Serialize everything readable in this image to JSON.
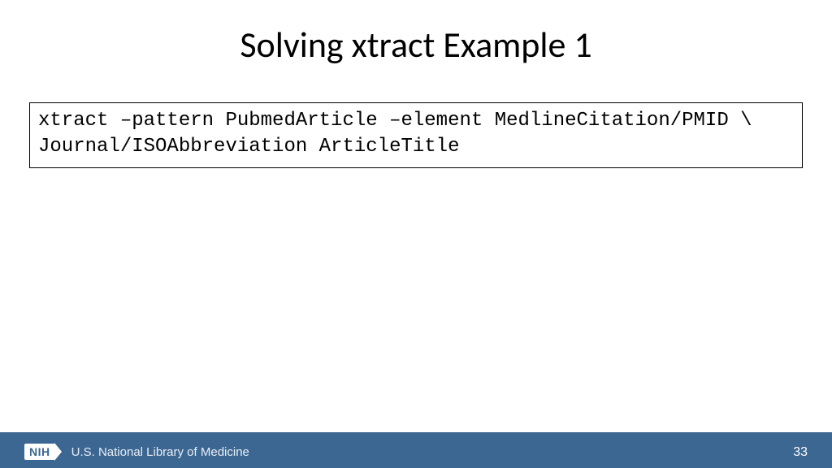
{
  "title": "Solving xtract Example 1",
  "code": {
    "line1": "xtract –pattern PubmedArticle –element MedlineCitation/PMID \\",
    "line2": "Journal/ISOAbbreviation ArticleTitle"
  },
  "footer": {
    "badge": "NIH",
    "org": "U.S. National Library of Medicine",
    "page": "33"
  }
}
